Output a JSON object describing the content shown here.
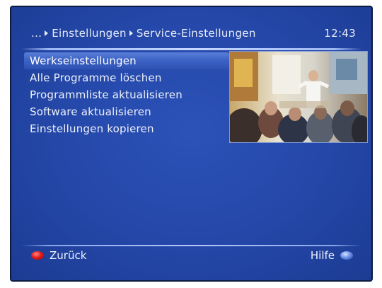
{
  "header": {
    "breadcrumb": [
      "...",
      "Einstellungen",
      "Service-Einstellungen"
    ],
    "clock": "12:43"
  },
  "menu": {
    "items": [
      {
        "label": "Werkseinstellungen",
        "selected": true
      },
      {
        "label": "Alle Programme löschen",
        "selected": false
      },
      {
        "label": "Programmliste aktualisieren",
        "selected": false
      },
      {
        "label": "Software aktualisieren",
        "selected": false
      },
      {
        "label": "Einstellungen kopieren",
        "selected": false
      }
    ]
  },
  "footer": {
    "back_label": "Zurück",
    "back_color": "#e41b1b",
    "help_label": "Hilfe",
    "help_color": "#6f90e8"
  }
}
